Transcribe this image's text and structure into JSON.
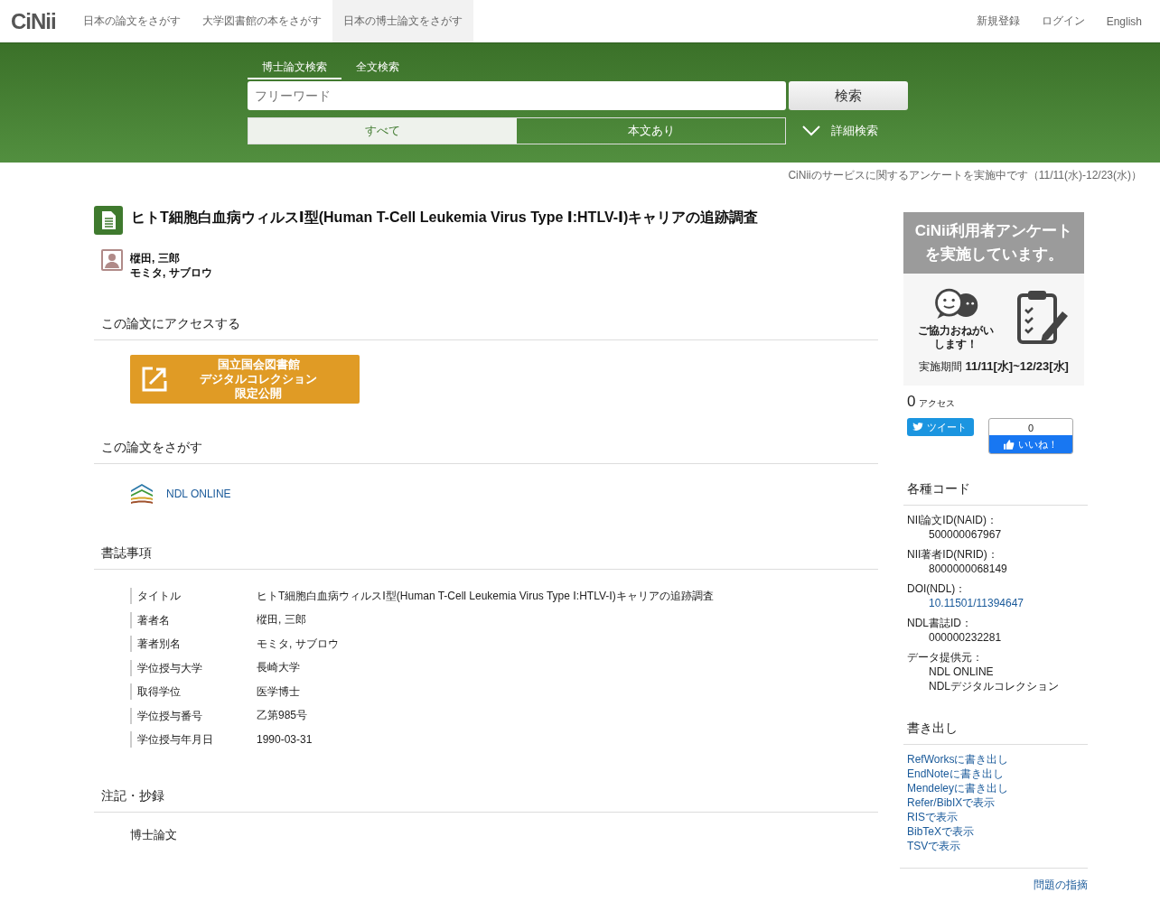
{
  "header": {
    "logo": "CiNii",
    "nav": [
      {
        "label": "日本の論文をさがす",
        "selected": false
      },
      {
        "label": "大学図書館の本をさがす",
        "selected": false
      },
      {
        "label": "日本の博士論文をさがす",
        "selected": true
      }
    ],
    "right_links": [
      "新規登録",
      "ログイン",
      "English"
    ]
  },
  "search": {
    "tabs": [
      {
        "label": "博士論文検索",
        "selected": true
      },
      {
        "label": "全文検索",
        "selected": false
      }
    ],
    "placeholder": "フリーワード",
    "button": "検索",
    "filters": [
      {
        "label": "すべて",
        "selected": true
      },
      {
        "label": "本文あり",
        "selected": false
      }
    ],
    "advanced": "詳細検索"
  },
  "notice": "CiNiiのサービスに関するアンケートを実施中です（11/11(水)-12/23(水)）",
  "article": {
    "title": "ヒトT細胞白血病ウィルスⅠ型(Human T-Cell Leukemia Virus Type Ⅰ:HTLV-Ⅰ)キャリアの追跡調査",
    "authors": [
      "樅田, 三郎",
      "モミタ, サブロウ"
    ],
    "access_heading": "この論文にアクセスする",
    "access_button": [
      "国立国会図書館",
      "デジタルコレクション",
      "限定公開"
    ],
    "find_heading": "この論文をさがす",
    "find_link": "NDL ONLINE",
    "biblio_heading": "書誌事項",
    "biblio": [
      {
        "label": "タイトル",
        "value": "ヒトT細胞白血病ウィルスⅠ型(Human T-Cell Leukemia Virus Type Ⅰ:HTLV-Ⅰ)キャリアの追跡調査"
      },
      {
        "label": "著者名",
        "value": "樅田, 三郎"
      },
      {
        "label": "著者別名",
        "value": "モミタ, サブロウ"
      },
      {
        "label": "学位授与大学",
        "value": "長崎大学"
      },
      {
        "label": "取得学位",
        "value": "医学博士"
      },
      {
        "label": "学位授与番号",
        "value": "乙第985号"
      },
      {
        "label": "学位授与年月日",
        "value": "1990-03-31"
      }
    ],
    "notes_heading": "注記・抄録",
    "notes": "博士論文"
  },
  "sidebar": {
    "banner": {
      "headline": [
        "CiNii利用者アンケート",
        "を実施しています。"
      ],
      "caption": [
        "ご協力おねがい",
        "します！"
      ],
      "period_label": "実施期間",
      "period": "11/11[水]~12/23[水]"
    },
    "access_count": "0",
    "access_label": "アクセス",
    "tweet": "ツイート",
    "like_count": "0",
    "like": "いいね！",
    "codes_heading": "各種コード",
    "codes": [
      {
        "label": "NII論文ID(NAID)：",
        "values": [
          {
            "text": "500000067967",
            "link": false
          }
        ]
      },
      {
        "label": "NII著者ID(NRID)：",
        "values": [
          {
            "text": "8000000068149",
            "link": false
          }
        ]
      },
      {
        "label": "DOI(NDL)：",
        "values": [
          {
            "text": "10.11501/11394647",
            "link": true
          }
        ]
      },
      {
        "label": "NDL書誌ID：",
        "values": [
          {
            "text": "000000232281",
            "link": false
          }
        ]
      },
      {
        "label": "データ提供元：",
        "values": [
          {
            "text": "NDL ONLINE",
            "link": false
          },
          {
            "text": "NDLデジタルコレクション",
            "link": false
          }
        ]
      }
    ],
    "export_heading": "書き出し",
    "exports": [
      "RefWorksに書き出し",
      "EndNoteに書き出し",
      "Mendeleyに書き出し",
      "Refer/BibIXで表示",
      "RISで表示",
      "BibTeXで表示",
      "TSVで表示"
    ],
    "report": "問題の指摘"
  }
}
